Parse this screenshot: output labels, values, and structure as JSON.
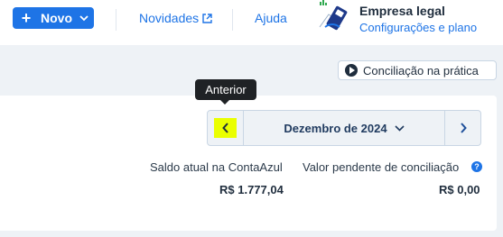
{
  "header": {
    "novo_label": "Novo",
    "novidades_label": "Novidades",
    "ajuda_label": "Ajuda",
    "company_name": "Empresa legal",
    "plan_link": "Configurações e plano"
  },
  "toolbar": {
    "practica_label": "Conciliação na prática"
  },
  "navigator": {
    "tooltip": "Anterior",
    "month": "Dezembro de 2024"
  },
  "summary": {
    "saldo_label": "Saldo atual na ContaAzul",
    "saldo_value": "R$ 1.777,04",
    "pendente_label": "Valor pendente de conciliação",
    "pendente_value": "R$ 0,00"
  },
  "colors": {
    "accent": "#1e74e6",
    "highlight": "#eaff00",
    "gray_bg": "#eef2f6"
  },
  "icons": [
    "plus-icon",
    "chevron-down-icon",
    "external-link-icon",
    "play-icon",
    "chevron-left-icon",
    "chevron-right-icon",
    "info-icon"
  ]
}
